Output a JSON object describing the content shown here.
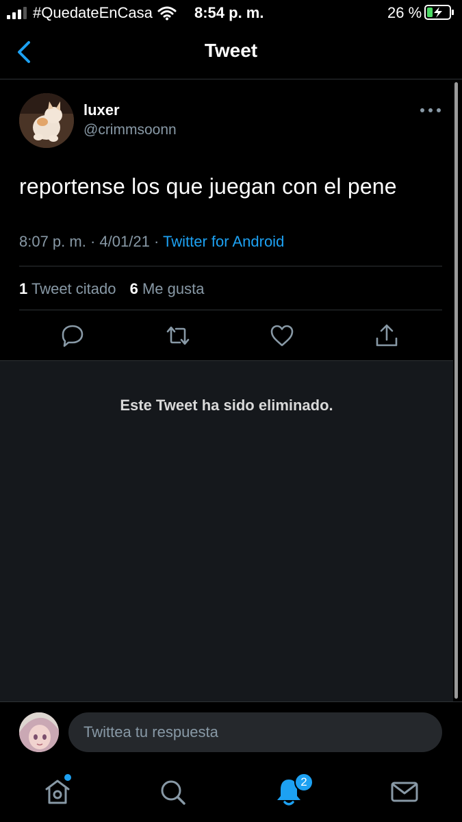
{
  "status_bar": {
    "carrier": "#QuedateEnCasa",
    "time": "8:54 p. m.",
    "battery_percent": "26 %",
    "battery_level": 0.26,
    "icons": [
      "signal-icon",
      "wifi-icon",
      "battery-charging-icon"
    ]
  },
  "header": {
    "title": "Tweet",
    "back_icon": "chevron-left-icon"
  },
  "tweet": {
    "display_name": "luxer",
    "handle": "@crimmsoonn",
    "text": "reportense los que juegan con el pene",
    "time": "8:07 p. m.",
    "separator": "·",
    "date": "4/01/21",
    "source": "Twitter for Android",
    "stats": {
      "quote_count": "1",
      "quote_label": "Tweet citado",
      "like_count": "6",
      "like_label": "Me gusta"
    },
    "actions": [
      "reply-icon",
      "retweet-icon",
      "like-icon",
      "share-icon"
    ]
  },
  "quoted": {
    "deleted_message": "Este Tweet ha sido eliminado."
  },
  "reply": {
    "placeholder": "Twittea tu respuesta"
  },
  "tabbar": {
    "items": [
      "home-icon",
      "search-icon",
      "notifications-icon",
      "messages-icon"
    ],
    "notifications_badge": "2"
  },
  "colors": {
    "accent": "#1da1f2",
    "background": "#000000",
    "muted_text": "#8899a6",
    "deleted_bg": "#15181c"
  }
}
